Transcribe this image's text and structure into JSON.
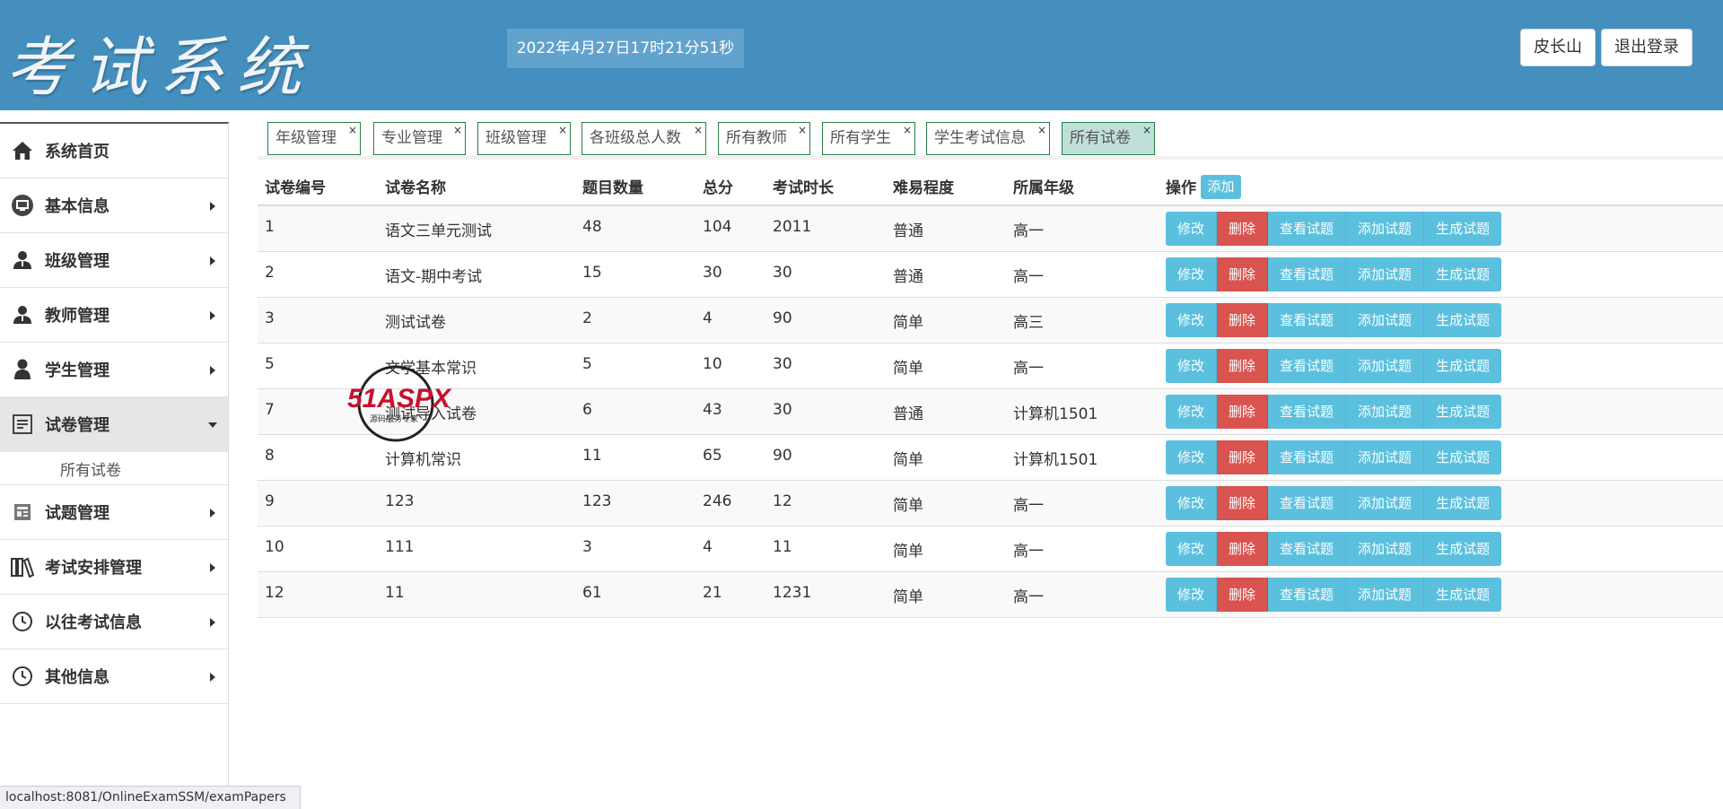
{
  "header": {
    "logo_text": "考试系统",
    "datetime": "2022年4月27日17时21分51秒",
    "user_button": "皮长山",
    "logout_button": "退出登录"
  },
  "sidebar": {
    "items": [
      {
        "label": "系统首页",
        "icon": "home-icon"
      },
      {
        "label": "基本信息",
        "icon": "monitor-icon"
      },
      {
        "label": "班级管理",
        "icon": "user-icon"
      },
      {
        "label": "教师管理",
        "icon": "user-icon"
      },
      {
        "label": "学生管理",
        "icon": "user-icon"
      },
      {
        "label": "试卷管理",
        "icon": "document-icon"
      },
      {
        "label": "试题管理",
        "icon": "newspaper-icon"
      },
      {
        "label": "考试安排管理",
        "icon": "books-icon"
      },
      {
        "label": "以往考试信息",
        "icon": "clock-icon"
      },
      {
        "label": "其他信息",
        "icon": "clock-icon"
      }
    ],
    "submenu_label": "所有试卷"
  },
  "tabs": [
    {
      "label": "年级管理"
    },
    {
      "label": "专业管理"
    },
    {
      "label": "班级管理"
    },
    {
      "label": "各班级总人数"
    },
    {
      "label": "所有教师"
    },
    {
      "label": "所有学生"
    },
    {
      "label": "学生考试信息"
    },
    {
      "label": "所有试卷"
    }
  ],
  "tab_close": "×",
  "table": {
    "headers": [
      "试卷编号",
      "试卷名称",
      "题目数量",
      "总分",
      "考试时长",
      "难易程度",
      "所属年级",
      "操作"
    ],
    "add_label": "添加",
    "actions": [
      "修改",
      "删除",
      "查看试题",
      "添加试题",
      "生成试题"
    ],
    "rows": [
      [
        "1",
        "语文三单元测试",
        "48",
        "104",
        "2011",
        "普通",
        "高一"
      ],
      [
        "2",
        "语文-期中考试",
        "15",
        "30",
        "30",
        "普通",
        "高一"
      ],
      [
        "3",
        "测试试卷",
        "2",
        "4",
        "90",
        "简单",
        "高三"
      ],
      [
        "5",
        "文学基本常识",
        "5",
        "10",
        "30",
        "简单",
        "高一"
      ],
      [
        "7",
        "测试导入试卷",
        "6",
        "43",
        "30",
        "普通",
        "计算机1501"
      ],
      [
        "8",
        "计算机常识",
        "11",
        "65",
        "90",
        "简单",
        "计算机1501"
      ],
      [
        "9",
        "123",
        "123",
        "246",
        "12",
        "简单",
        "高一"
      ],
      [
        "10",
        "111",
        "3",
        "4",
        "11",
        "简单",
        "高一"
      ],
      [
        "12",
        "11",
        "61",
        "21",
        "1231",
        "简单",
        "高一"
      ]
    ]
  },
  "watermark": {
    "brand": "51ASPX",
    "tagline": "源码服务专家"
  },
  "statusbar": {
    "url": "localhost:8081/OnlineExamSSM/examPapers"
  },
  "colors": {
    "header": "#448fbd",
    "info_button": "#5bc0de",
    "danger_button": "#d9534f",
    "tab_border": "#2a7f45",
    "active_tab": "#bfe0d8"
  }
}
